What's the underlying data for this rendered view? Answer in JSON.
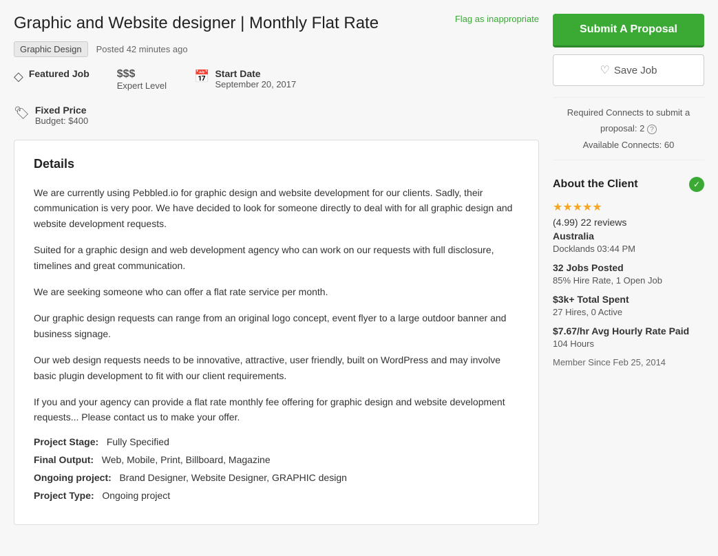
{
  "page": {
    "flag_label": "Flag as inappropriate",
    "job_title": "Graphic and Website designer | Monthly Flat Rate",
    "tag": "Graphic Design",
    "posted_time": "Posted 42 minutes ago",
    "featured_label": "Featured Job",
    "price_level": "$$$",
    "experience_level": "Expert Level",
    "start_date_label": "Start Date",
    "start_date": "September 20, 2017",
    "fixed_price_label": "Fixed Price",
    "budget": "Budget: $400",
    "details_title": "Details",
    "description_1": "We are currently using Pebbled.io for graphic design and website development for our clients.  Sadly, their communication is very poor.  We have decided to look for someone directly to deal with for all graphic design and website development requests.",
    "description_2": "Suited for a graphic design and web development agency who can work on our requests with full disclosure, timelines and great communication.",
    "description_3": "We are seeking someone who can offer a flat rate service per month.",
    "description_4": "Our graphic design requests can range from an original logo concept, event flyer to a large outdoor banner and business signage.",
    "description_5": "Our web design requests needs to be innovative, attractive, user friendly, built on WordPress and may involve basic plugin development to fit with our client requirements.",
    "description_6": "If you and your agency can provide a flat rate monthly fee offering for graphic design and website development requests... Please contact us to make your offer.",
    "project_stage_label": "Project Stage:",
    "project_stage_value": "Fully Specified",
    "final_output_label": "Final Output:",
    "final_output_value": "Web, Mobile, Print, Billboard, Magazine",
    "ongoing_project_label": "Ongoing project:",
    "ongoing_project_value": "Brand Designer, Website Designer, GRAPHIC design",
    "project_type_label": "Project Type:",
    "project_type_value": "Ongoing project",
    "submit_btn_label": "Submit A Proposal",
    "save_btn_label": "Save Job",
    "connects_required_text": "Required Connects to submit a",
    "connects_required_text2": "proposal: 2",
    "connects_available": "Available Connects: 60",
    "about_client_title": "About the Client",
    "rating": "4.99",
    "reviews_count": "22",
    "reviews_label": "reviews",
    "stars_display": "★★★★★",
    "client_country": "Australia",
    "client_location": "Docklands 03:44 PM",
    "jobs_posted_label": "32 Jobs Posted",
    "hire_rate": "85% Hire Rate, 1 Open Job",
    "total_spent_label": "$3k+ Total Spent",
    "hires_active": "27 Hires, 0 Active",
    "avg_rate_label": "$7.67/hr Avg Hourly Rate Paid",
    "hours": "104 Hours",
    "member_since": "Member Since Feb 25, 2014"
  }
}
